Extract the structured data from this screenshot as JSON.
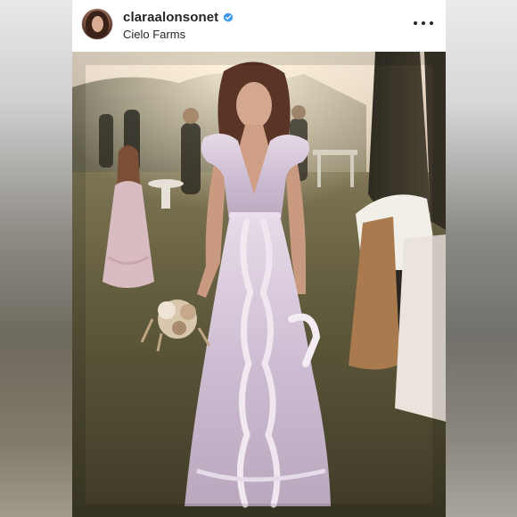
{
  "post": {
    "username": "claraalonsonet",
    "verified": true,
    "location": "Cielo Farms",
    "menu_icon": "more-horizontal-icon",
    "avatar_icon": "profile-avatar",
    "photo_subject": "woman-in-lilac-ruffled-dress-photo"
  },
  "colors": {
    "verified_badge": "#3897f0",
    "text": "#262626"
  }
}
